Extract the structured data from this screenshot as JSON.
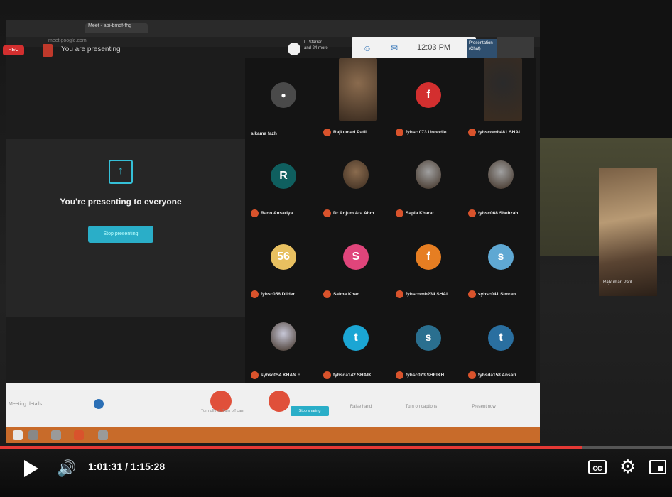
{
  "browser": {
    "tabs": [
      "",
      "Meet - abi-bmdf-fhg",
      "",
      "",
      "",
      ""
    ],
    "url": "meet.google.com"
  },
  "meet": {
    "rec_label": "REC",
    "presenting_label": "You are presenting",
    "others_text": [
      "L. Starrar",
      "and 24 more"
    ],
    "clock": "12:03 PM",
    "chat_label": "Presentation (Chat)",
    "center_message": "You're presenting to everyone",
    "stop_presenting": "Stop presenting",
    "upload_icon": "↑",
    "participants": [
      {
        "name": "alkama fazh",
        "initial": "",
        "color": "#3a3a3a",
        "type": "mic"
      },
      {
        "name": "Rajkumari Patil",
        "initial": "",
        "color": "#8a6b4e",
        "type": "photo"
      },
      {
        "name": "fybsc 073 Unnodle",
        "initial": "f",
        "color": "#d32f2f",
        "type": "letter"
      },
      {
        "name": "fybscomb481 SHAI",
        "initial": "",
        "color": "#2a2a2a",
        "type": "photo"
      },
      {
        "name": "Rano Ansariya",
        "initial": "R",
        "color": "#0f5f5f",
        "type": "letter"
      },
      {
        "name": "Dr Anjum Ara Ahm",
        "initial": "",
        "color": "#8a6b4e",
        "type": "photo"
      },
      {
        "name": "Sapia Kharat",
        "initial": "",
        "color": "#a0a0a0",
        "type": "photo"
      },
      {
        "name": "fybsc068 Shehzah",
        "initial": "",
        "color": "#a0a0a0",
        "type": "photo"
      },
      {
        "name": "fybsc056 Dilder",
        "initial": "56",
        "color": "#e8c060",
        "type": "letter"
      },
      {
        "name": "Saima Khan",
        "initial": "S",
        "color": "#e0457b",
        "type": "letter"
      },
      {
        "name": "fybscomb234 SHAI",
        "initial": "f",
        "color": "#e67e22",
        "type": "letter"
      },
      {
        "name": "sybsc041 Simran",
        "initial": "s",
        "color": "#5fa8d3",
        "type": "letter"
      },
      {
        "name": "sybsc054 KHAN F",
        "initial": "",
        "color": "#c8c8d8",
        "type": "photo"
      },
      {
        "name": "tybsda142 SHAIK",
        "initial": "t",
        "color": "#1ba6d4",
        "type": "letter"
      },
      {
        "name": "tybsc073 SHEIKH",
        "initial": "s",
        "color": "#2a6f8f",
        "type": "letter"
      },
      {
        "name": "fybsda158 Ansari",
        "initial": "t",
        "color": "#2a6fa0",
        "type": "letter"
      }
    ],
    "side_camera_name": "Rajkumari Patil",
    "bottom": {
      "meeting_details": "Meeting details",
      "turn_off_text": "Turn off mic Turn off cam",
      "stop_presenting_small": "Stop sharing",
      "raise_hand": "Raise hand",
      "turn_on_captions": "Turn on captions",
      "present_now": "Present now"
    }
  },
  "player": {
    "current_time": "1:01:31",
    "duration": "1:15:28",
    "time_display": "1:01:31 / 1:15:28",
    "progress_fraction": 0.867,
    "cc_label": "CC",
    "accent": "#e53935"
  }
}
